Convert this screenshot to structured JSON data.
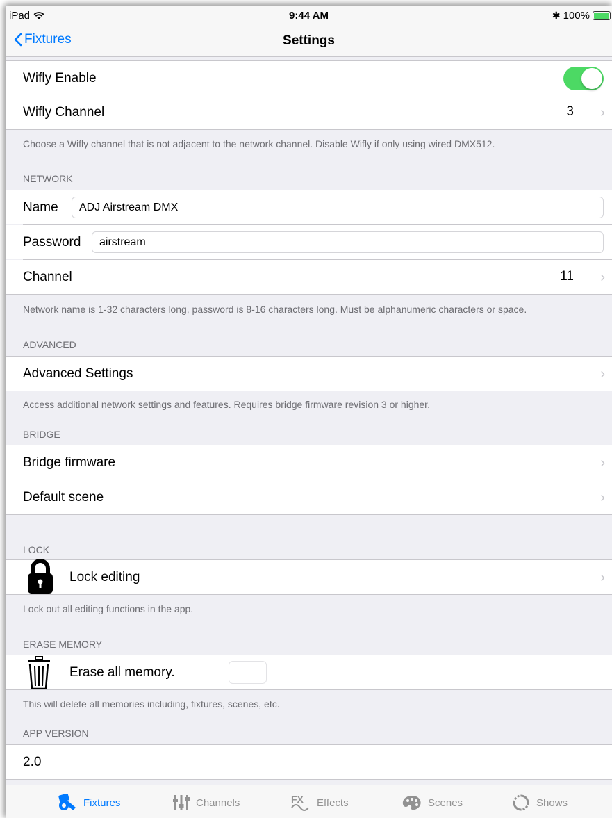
{
  "status_bar": {
    "device": "iPad",
    "time": "9:44 AM",
    "battery": "100%"
  },
  "nav": {
    "back_label": "Fixtures",
    "title": "Settings"
  },
  "wifly": {
    "enable_label": "Wifly Enable",
    "enable_on": true,
    "channel_label": "Wifly Channel",
    "channel_value": "3",
    "footer": "Choose a Wifly channel that is not adjacent to the network channel. Disable Wifly if only using wired DMX512."
  },
  "network": {
    "header": "NETWORK",
    "name_label": "Name",
    "name_value": "ADJ Airstream DMX",
    "password_label": "Password",
    "password_value": "airstream",
    "channel_label": "Channel",
    "channel_value": "11",
    "footer": "Network name is 1-32 characters long, password is 8-16 characters long. Must be alphanumeric characters or space."
  },
  "advanced": {
    "header": "ADVANCED",
    "settings_label": "Advanced Settings",
    "footer": "Access additional network settings and features. Requires bridge firmware revision 3 or higher."
  },
  "bridge": {
    "header": "BRIDGE",
    "firmware_label": "Bridge firmware",
    "default_scene_label": "Default scene"
  },
  "lock": {
    "header": "LOCK",
    "label": "Lock editing",
    "footer": "Lock out all editing functions in the app."
  },
  "erase": {
    "header": "ERASE MEMORY",
    "label": "Erase all memory.",
    "footer": "This will delete all memories including, fixtures, scenes, etc."
  },
  "app_version": {
    "header": "APP VERSION",
    "value": "2.0"
  },
  "tabs": [
    {
      "label": "Fixtures",
      "icon": "fixtures-icon",
      "active": true
    },
    {
      "label": "Channels",
      "icon": "channels-icon",
      "active": false
    },
    {
      "label": "Effects",
      "icon": "effects-icon",
      "active": false
    },
    {
      "label": "Scenes",
      "icon": "scenes-icon",
      "active": false
    },
    {
      "label": "Shows",
      "icon": "shows-icon",
      "active": false
    }
  ],
  "colors": {
    "accent": "#007aff",
    "toggle_on": "#4cd964",
    "background": "#efeff4"
  }
}
